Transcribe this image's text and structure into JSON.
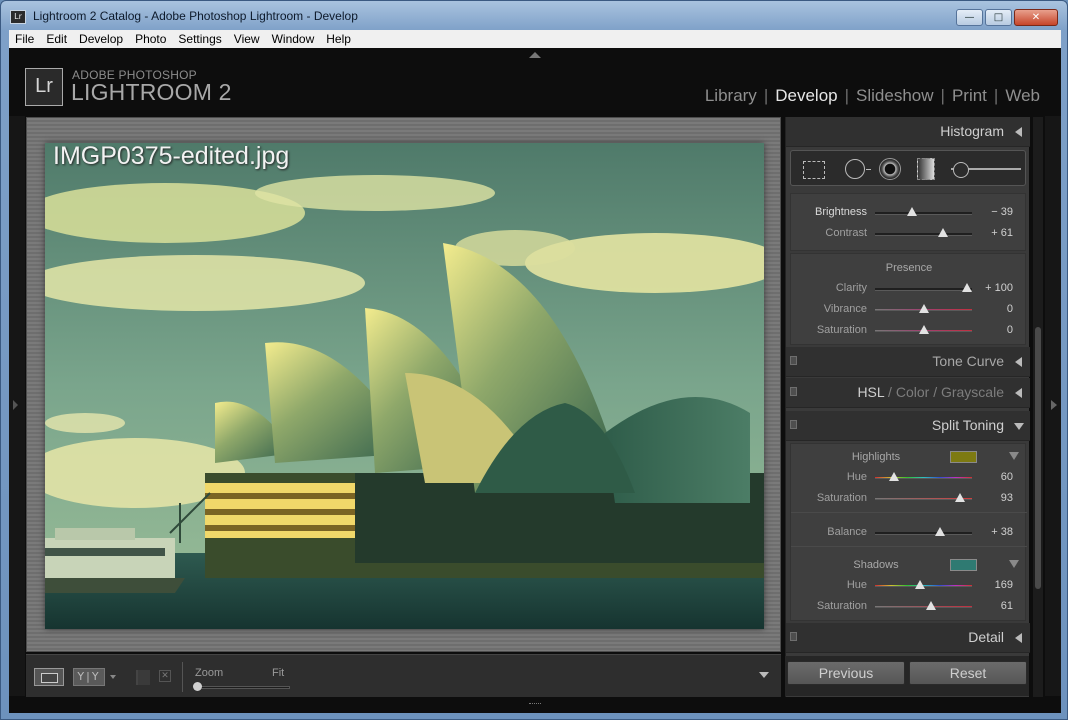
{
  "window": {
    "title": "Lightroom 2 Catalog - Adobe Photoshop Lightroom - Develop",
    "icon_text": "Lr"
  },
  "menubar": [
    "File",
    "Edit",
    "Develop",
    "Photo",
    "Settings",
    "View",
    "Window",
    "Help"
  ],
  "branding": {
    "logo": "Lr",
    "line1": "ADOBE PHOTOSHOP",
    "line2": "LIGHTROOM 2"
  },
  "modules": [
    {
      "label": "Library",
      "active": false
    },
    {
      "label": "Develop",
      "active": true
    },
    {
      "label": "Slideshow",
      "active": false
    },
    {
      "label": "Print",
      "active": false
    },
    {
      "label": "Web",
      "active": false
    }
  ],
  "photo": {
    "filename": "IMGP0375-edited.jpg"
  },
  "toolbar": {
    "view_icon": "loupe-view-icon",
    "compare_label": "Y|Y",
    "zoom_label": "Zoom",
    "fit_label": "Fit",
    "zoom_level": 0
  },
  "panels": {
    "histogram": {
      "label": "Histogram"
    },
    "tools": [
      "crop-icon",
      "spot-removal-icon",
      "red-eye-icon",
      "graduated-filter-icon",
      "adjustment-brush-icon"
    ],
    "basic": {
      "rows": [
        {
          "label": "Brightness",
          "value": "− 39",
          "level": 0.38
        },
        {
          "label": "Contrast",
          "value": "+ 61",
          "level": 0.7
        }
      ],
      "presence_title": "Presence",
      "presence": [
        {
          "label": "Clarity",
          "value": "+ 100",
          "level": 0.95
        },
        {
          "label": "Vibrance",
          "value": "0",
          "level": 0.5
        },
        {
          "label": "Saturation",
          "value": "0",
          "level": 0.5
        }
      ]
    },
    "tone_curve": {
      "label": "Tone Curve"
    },
    "hsl": {
      "hsl": "HSL",
      "sep": "/",
      "color": "Color",
      "grayscale": "Grayscale"
    },
    "split_toning": {
      "label": "Split Toning",
      "highlights": {
        "title": "Highlights",
        "swatch_color": "#7d7a12",
        "hue": {
          "label": "Hue",
          "value": "60",
          "level": 0.2
        },
        "saturation": {
          "label": "Saturation",
          "value": "93",
          "level": 0.88
        }
      },
      "balance": {
        "label": "Balance",
        "value": "+ 38",
        "level": 0.67
      },
      "shadows": {
        "title": "Shadows",
        "swatch_color": "#2f7a72",
        "hue": {
          "label": "Hue",
          "value": "169",
          "level": 0.46
        },
        "saturation": {
          "label": "Saturation",
          "value": "61",
          "level": 0.58
        }
      }
    },
    "detail": {
      "label": "Detail"
    }
  },
  "buttons": {
    "previous": "Previous",
    "reset": "Reset"
  },
  "colors": {
    "sky_tone": "#6f9a86",
    "highlight_yellow": "#e8e07a",
    "water": "#1f3f3a"
  }
}
